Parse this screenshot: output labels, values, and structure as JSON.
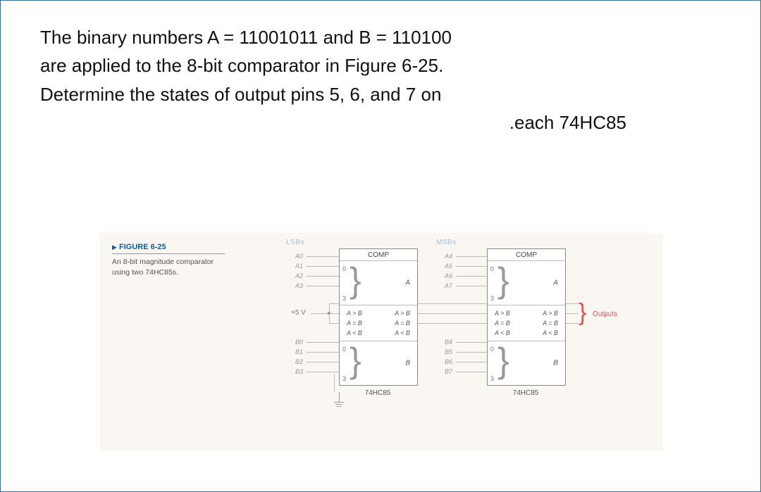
{
  "problem": {
    "line1": "The binary numbers A = 11001011 and B = 110100",
    "line2": "are applied to the 8-bit comparator in Figure 6-25.",
    "line3": "Determine the states of output pins 5, 6, and 7 on",
    "line4": ".each 74HC85"
  },
  "figure": {
    "label": "FIGURE 6-25",
    "desc1": "An 8-bit magnitude comparator",
    "desc2": "using two 74HC85s.",
    "lsbs_header": "LSBs",
    "msbs_header": "MSBs",
    "comp_title": "COMP",
    "group_a": "A",
    "group_b": "B",
    "pins": {
      "p0": "0",
      "p3": "3"
    },
    "a_inputs_lsb": [
      "A0",
      "A1",
      "A2",
      "A3"
    ],
    "b_inputs_lsb": [
      "B0",
      "B1",
      "B2",
      "B3"
    ],
    "a_inputs_msb": [
      "A4",
      "A5",
      "A6",
      "A7"
    ],
    "b_inputs_msb": [
      "B4",
      "B5",
      "B6",
      "B7"
    ],
    "mid_rows_left": [
      "A > B",
      "A = B",
      "A < B"
    ],
    "mid_rows_right": [
      "A > B",
      "A = B",
      "A < B"
    ],
    "chip_name": "74HC85",
    "vcc_label": "+5 V",
    "outputs_label": "Outputs"
  }
}
